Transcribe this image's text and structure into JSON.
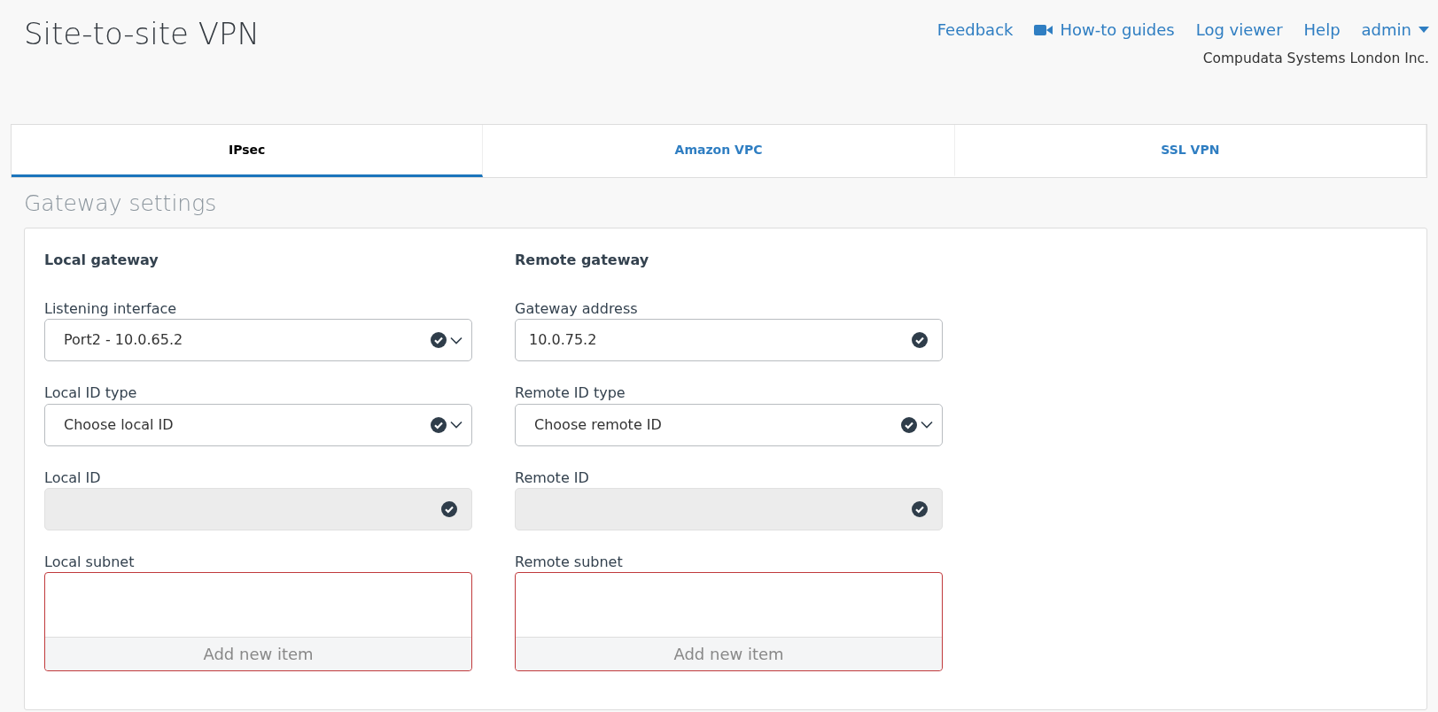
{
  "page_title": "Site-to-site VPN",
  "top_links": [
    {
      "label": "Feedback",
      "kind": "link"
    },
    {
      "label": "How-to guides",
      "kind": "video"
    },
    {
      "label": "Log viewer",
      "kind": "link"
    },
    {
      "label": "Help",
      "kind": "link"
    },
    {
      "label": "admin",
      "kind": "menu"
    }
  ],
  "organization": "Compudata Systems London Inc.",
  "tabs": [
    {
      "label": "IPsec",
      "selected": true
    },
    {
      "label": "Amazon VPC",
      "selected": false
    },
    {
      "label": "SSL VPN",
      "selected": false
    }
  ],
  "section_title": "Gateway settings",
  "gateways": [
    {
      "heading": "Local gateway",
      "fields": [
        {
          "label": "Listening interface",
          "kind": "select",
          "value": "Port2 - 10.0.65.2",
          "disabled": false
        },
        {
          "label": "Local ID type",
          "kind": "select",
          "value": "Choose local ID",
          "disabled": false
        },
        {
          "label": "Local ID",
          "kind": "input",
          "disabled": true
        },
        {
          "label": "Local subnet",
          "kind": "list",
          "add_label": "Add new item",
          "invalid": true
        }
      ]
    },
    {
      "heading": "Remote gateway",
      "fields": [
        {
          "label": "Gateway address",
          "kind": "input",
          "value": "10.0.75.2",
          "disabled": false
        },
        {
          "label": "Remote ID type",
          "kind": "select",
          "value": "Choose remote ID",
          "disabled": false
        },
        {
          "label": "Remote ID",
          "kind": "input",
          "disabled": true
        },
        {
          "label": "Remote subnet",
          "kind": "list",
          "add_label": "Add new item",
          "invalid": true
        }
      ]
    }
  ]
}
